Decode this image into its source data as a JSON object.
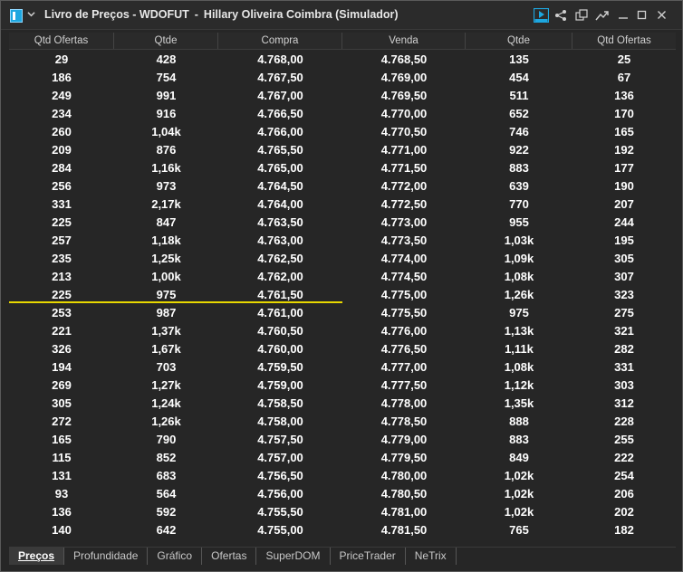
{
  "window": {
    "title_main": "Livro de Preços - WDOFUT",
    "title_sep": "-",
    "title_account": "Hillary Oliveira Coimbra (Simulador)"
  },
  "toolbar_icons": [
    "play-icon",
    "share-icon",
    "detach-icon",
    "trend-icon",
    "minimize-icon",
    "maximize-icon",
    "close-icon"
  ],
  "columns": [
    "Qtd Ofertas",
    "Qtde",
    "Compra",
    "Venda",
    "Qtde",
    "Qtd Ofertas"
  ],
  "rows": [
    [
      "29",
      "428",
      "4.768,00",
      "4.768,50",
      "135",
      "25"
    ],
    [
      "186",
      "754",
      "4.767,50",
      "4.769,00",
      "454",
      "67"
    ],
    [
      "249",
      "991",
      "4.767,00",
      "4.769,50",
      "511",
      "136"
    ],
    [
      "234",
      "916",
      "4.766,50",
      "4.770,00",
      "652",
      "170"
    ],
    [
      "260",
      "1,04k",
      "4.766,00",
      "4.770,50",
      "746",
      "165"
    ],
    [
      "209",
      "876",
      "4.765,50",
      "4.771,00",
      "922",
      "192"
    ],
    [
      "284",
      "1,16k",
      "4.765,00",
      "4.771,50",
      "883",
      "177"
    ],
    [
      "256",
      "973",
      "4.764,50",
      "4.772,00",
      "639",
      "190"
    ],
    [
      "331",
      "2,17k",
      "4.764,00",
      "4.772,50",
      "770",
      "207"
    ],
    [
      "225",
      "847",
      "4.763,50",
      "4.773,00",
      "955",
      "244"
    ],
    [
      "257",
      "1,18k",
      "4.763,00",
      "4.773,50",
      "1,03k",
      "195"
    ],
    [
      "235",
      "1,25k",
      "4.762,50",
      "4.774,00",
      "1,09k",
      "305"
    ],
    [
      "213",
      "1,00k",
      "4.762,00",
      "4.774,50",
      "1,08k",
      "307"
    ],
    [
      "225",
      "975",
      "4.761,50",
      "4.775,00",
      "1,26k",
      "323"
    ],
    [
      "253",
      "987",
      "4.761,00",
      "4.775,50",
      "975",
      "275"
    ],
    [
      "221",
      "1,37k",
      "4.760,50",
      "4.776,00",
      "1,13k",
      "321"
    ],
    [
      "326",
      "1,67k",
      "4.760,00",
      "4.776,50",
      "1,11k",
      "282"
    ],
    [
      "194",
      "703",
      "4.759,50",
      "4.777,00",
      "1,08k",
      "331"
    ],
    [
      "269",
      "1,27k",
      "4.759,00",
      "4.777,50",
      "1,12k",
      "303"
    ],
    [
      "305",
      "1,24k",
      "4.758,50",
      "4.778,00",
      "1,35k",
      "312"
    ],
    [
      "272",
      "1,26k",
      "4.758,00",
      "4.778,50",
      "888",
      "228"
    ],
    [
      "165",
      "790",
      "4.757,50",
      "4.779,00",
      "883",
      "255"
    ],
    [
      "115",
      "852",
      "4.757,00",
      "4.779,50",
      "849",
      "222"
    ],
    [
      "131",
      "683",
      "4.756,50",
      "4.780,00",
      "1,02k",
      "254"
    ],
    [
      "93",
      "564",
      "4.756,00",
      "4.780,50",
      "1,02k",
      "206"
    ],
    [
      "136",
      "592",
      "4.755,50",
      "4.781,00",
      "1,02k",
      "202"
    ],
    [
      "140",
      "642",
      "4.755,00",
      "4.781,50",
      "765",
      "182"
    ]
  ],
  "tabs": [
    "Preços",
    "Profundidade",
    "Gráfico",
    "Ofertas",
    "SuperDOM",
    "PriceTrader",
    "NeTrix"
  ],
  "active_tab": "Preços",
  "colors": {
    "background": "#262626",
    "text": "#ffffff",
    "separator_line": "#e8d800",
    "accent_icon": "#1da7e0"
  }
}
